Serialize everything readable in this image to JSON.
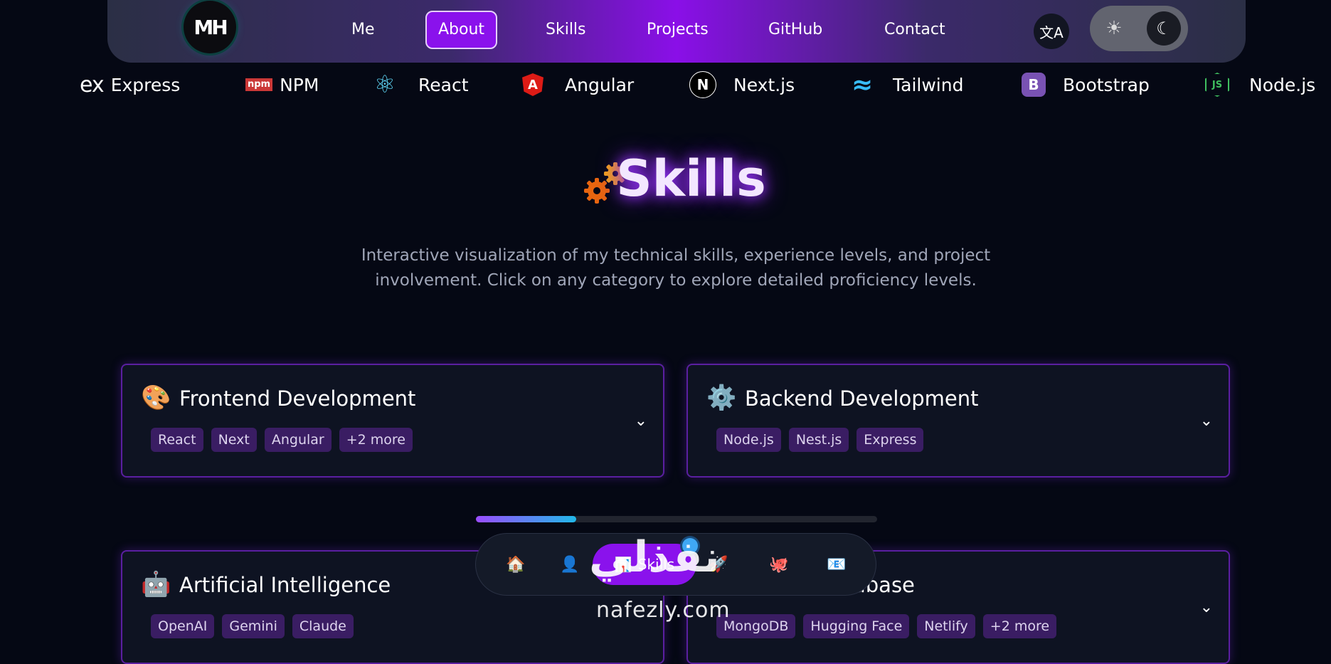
{
  "nav": {
    "logo_text": "MH",
    "links": [
      "Me",
      "About",
      "Skills",
      "Projects",
      "GitHub",
      "Contact"
    ],
    "active": "About",
    "translate_icon": "translate-icon",
    "theme_icons": [
      "sun-icon",
      "moon-icon"
    ]
  },
  "tech_strip": [
    {
      "label": "Express",
      "icon": "ex"
    },
    {
      "label": "NPM",
      "icon": "npm"
    },
    {
      "label": "React",
      "icon": "⚛"
    },
    {
      "label": "Angular",
      "icon": "A"
    },
    {
      "label": "Next.js",
      "icon": "N"
    },
    {
      "label": "Tailwind",
      "icon": "≈"
    },
    {
      "label": "Bootstrap",
      "icon": "B"
    },
    {
      "label": "Node.js",
      "icon": "JS"
    }
  ],
  "page": {
    "title": "Skills",
    "subtitle": "Interactive visualization of my technical skills, experience levels, and project involvement. Click on any category to explore detailed proficiency levels."
  },
  "cards": [
    {
      "emoji": "🎨",
      "title": "Frontend Development",
      "tags": [
        "React",
        "Next",
        "Angular",
        "+2 more"
      ]
    },
    {
      "emoji": "⚙️",
      "title": "Backend Development",
      "tags": [
        "Node.js",
        "Nest.js",
        "Express"
      ]
    },
    {
      "emoji": "🤖",
      "title": "Artificial Intelligence",
      "tags": [
        "OpenAI",
        "Gemini",
        "Claude"
      ]
    },
    {
      "emoji": "",
      "title": "abase",
      "tags": [
        "MongoDB",
        "Hugging Face",
        "Netlify",
        "+2 more"
      ]
    }
  ],
  "progress": {
    "value_percent": 25
  },
  "dock": {
    "items": [
      "🏠",
      "👤",
      "📊",
      "🚀",
      "🐙",
      "📧"
    ],
    "active_label": "Skills"
  },
  "watermark": {
    "arabic": "نفذلي",
    "latin": "nafezly.com"
  },
  "colors": {
    "accent": "#8a12ec",
    "tag_bg": "#3a1d63",
    "background": "#050814"
  }
}
